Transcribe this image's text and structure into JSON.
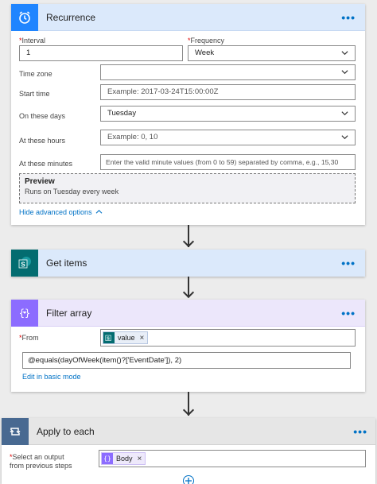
{
  "recurrence": {
    "title": "Recurrence",
    "menu_glyph": "•••",
    "interval": {
      "label": "Interval",
      "value": "1"
    },
    "frequency": {
      "label": "Frequency",
      "value": "Week"
    },
    "timezone": {
      "label": "Time zone",
      "value": ""
    },
    "start_time": {
      "label": "Start time",
      "placeholder": "Example: 2017-03-24T15:00:00Z"
    },
    "on_days": {
      "label": "On these days",
      "value": "Tuesday"
    },
    "at_hours": {
      "label": "At these hours",
      "placeholder": "Example: 0, 10"
    },
    "at_minutes": {
      "label": "At these minutes",
      "placeholder": "Enter the valid minute values (from 0 to 59) separated by comma, e.g., 15,30"
    },
    "preview": {
      "title": "Preview",
      "text": "Runs on Tuesday every week"
    },
    "hide_advanced": "Hide advanced options",
    "required_mark": "*",
    "icon": "alarm-clock-icon",
    "accent": "#1f85ff"
  },
  "get_items": {
    "title": "Get items",
    "menu_glyph": "•••",
    "icon": "sharepoint-icon",
    "accent": "#036c70"
  },
  "filter_array": {
    "title": "Filter array",
    "menu_glyph": "•••",
    "from_label": "From",
    "required_mark": "*",
    "from_token": "value",
    "token_close": "×",
    "expression": "@equals(dayOfWeek(item()?['EventDate']), 2)",
    "edit_basic": "Edit in basic mode",
    "icon": "filter-braces-icon",
    "accent": "#8c6cff"
  },
  "apply_each": {
    "title": "Apply to each",
    "menu_glyph": "•••",
    "select_label_1": "Select an output",
    "select_label_2": "from previous steps",
    "required_mark": "*",
    "token": "Body",
    "token_close": "×",
    "icon": "loop-icon",
    "accent": "#486991"
  }
}
